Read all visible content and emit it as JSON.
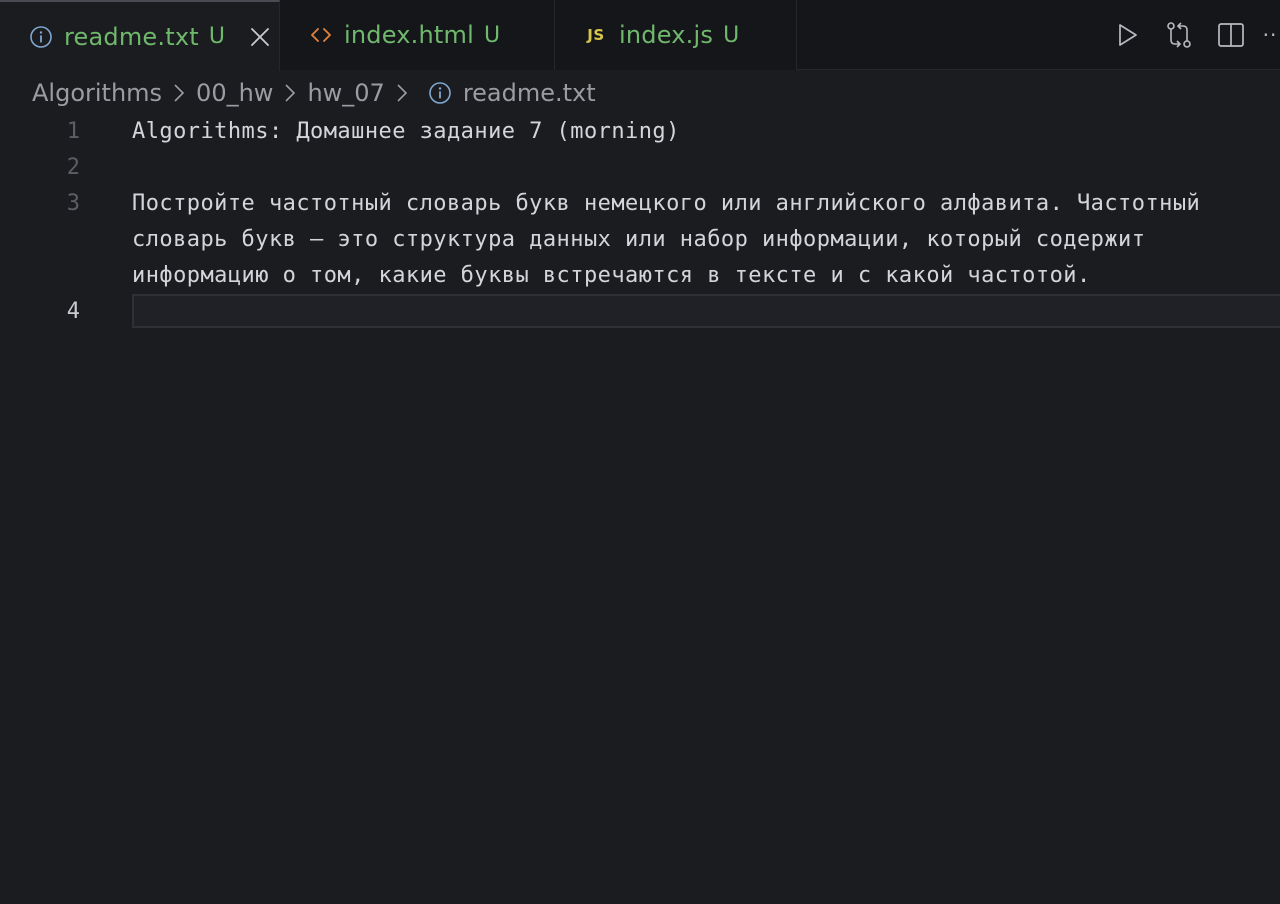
{
  "tabs": [
    {
      "label": "readme.txt",
      "status": "U",
      "icon": "info-icon",
      "active": true
    },
    {
      "label": "index.html",
      "status": "U",
      "icon": "code-brackets-icon",
      "active": false
    },
    {
      "label": "index.js",
      "status": "U",
      "icon": "js-file-icon",
      "badge": "JS",
      "active": false
    }
  ],
  "actions": [
    {
      "icon": "run-icon"
    },
    {
      "icon": "source-control-compare-icon"
    },
    {
      "icon": "split-editor-icon"
    },
    {
      "icon": "more-actions-icon",
      "label": "··"
    }
  ],
  "breadcrumb": {
    "items": [
      "Algorithms",
      "00_hw",
      "hw_07",
      "readme.txt"
    ]
  },
  "editor": {
    "lines": [
      {
        "number": "1",
        "text": "Algorithms: Домашнее задание 7 (morning)"
      },
      {
        "number": "2",
        "text": ""
      },
      {
        "number": "3",
        "text": "Постройте частотный словарь букв немецкого или английского алфавита. Частотный",
        "wrap1": "словарь букв – это структура данных или набор информации, который содержит",
        "wrap2": "информацию о том, какие буквы встречаются в тексте и с какой частотой."
      },
      {
        "number": "4",
        "text": ""
      }
    ]
  },
  "colors": {
    "background": "#1b1c20",
    "tab_bar": "#15161a",
    "untracked_green": "#6fb86c",
    "info_blue": "#7fa7cf",
    "html_orange": "#e0813a",
    "js_yellow": "#d7c64b"
  }
}
